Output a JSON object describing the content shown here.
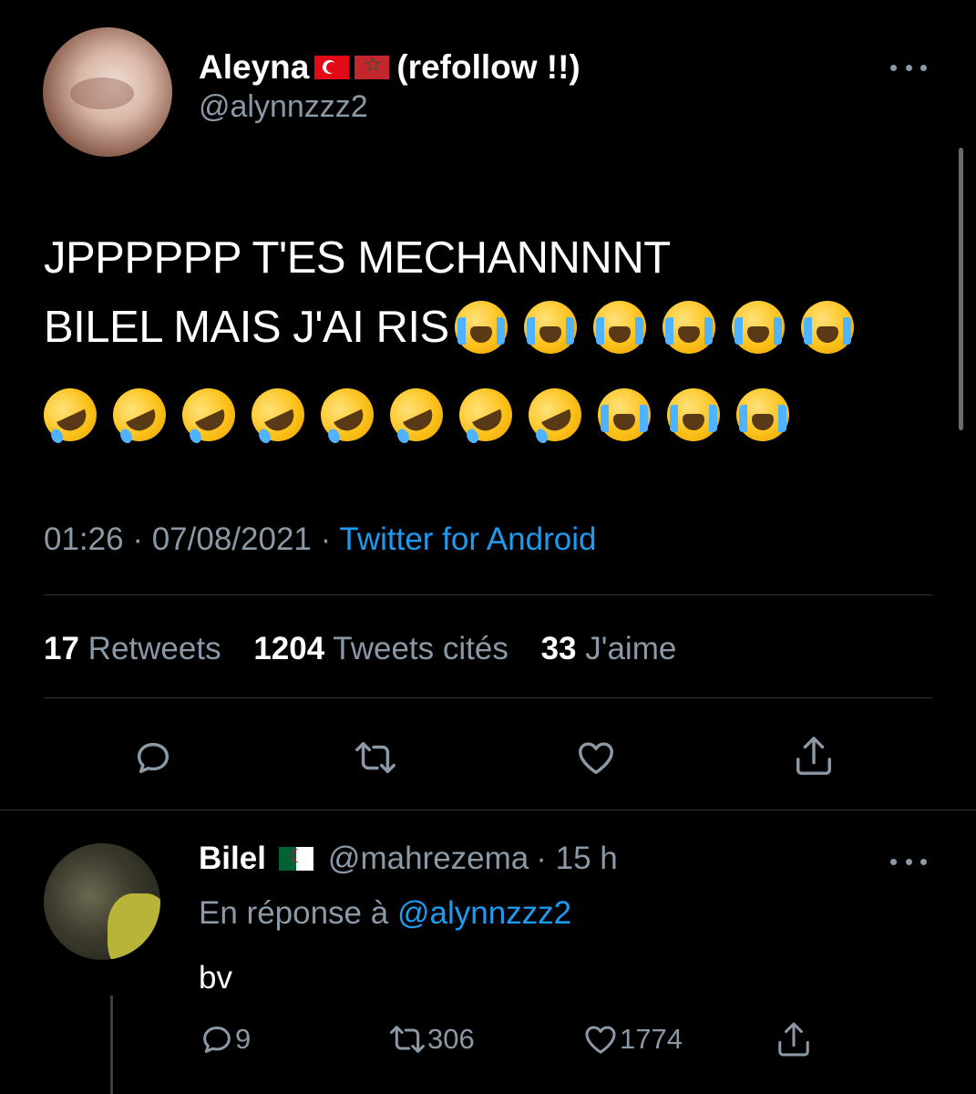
{
  "main_tweet": {
    "display_name": "Aleyna",
    "name_suffix": "(refollow !!)",
    "handle": "@alynnzzz2",
    "text_line1": "JPPPPPP T'ES MECHANNNNT",
    "text_line2": "BILEL MAIS J'AI RIS",
    "emojis_line2": [
      "loudly-crying-face",
      "loudly-crying-face",
      "loudly-crying-face",
      "loudly-crying-face",
      "loudly-crying-face",
      "loudly-crying-face"
    ],
    "emojis_line3": [
      "rofl-face",
      "rofl-face",
      "rofl-face",
      "rofl-face",
      "rofl-face",
      "rofl-face",
      "rofl-face",
      "rofl-face",
      "loudly-crying-face",
      "loudly-crying-face",
      "loudly-crying-face"
    ],
    "time": "01:26",
    "date": "07/08/2021",
    "separator": "·",
    "source": "Twitter for Android",
    "stats": {
      "retweets_count": "17",
      "retweets_label": "Retweets",
      "quotes_count": "1204",
      "quotes_label": "Tweets cités",
      "likes_count": "33",
      "likes_label": "J'aime"
    },
    "actions": [
      "reply-icon",
      "retweet-icon",
      "like-icon",
      "share-icon"
    ]
  },
  "reply_tweet": {
    "display_name": "Bilel",
    "handle": "@mahrezema",
    "time_ago": "· 15 h",
    "reply_prefix": "En réponse à",
    "reply_mention": "@alynnzzz2",
    "text": "bv",
    "reply_count": "9",
    "retweet_count": "306",
    "like_count": "1774"
  },
  "colors": {
    "background": "#000000",
    "text_primary": "#ffffff",
    "text_secondary": "#8b98a5",
    "accent": "#1d9bf0",
    "divider": "#2f3336"
  }
}
